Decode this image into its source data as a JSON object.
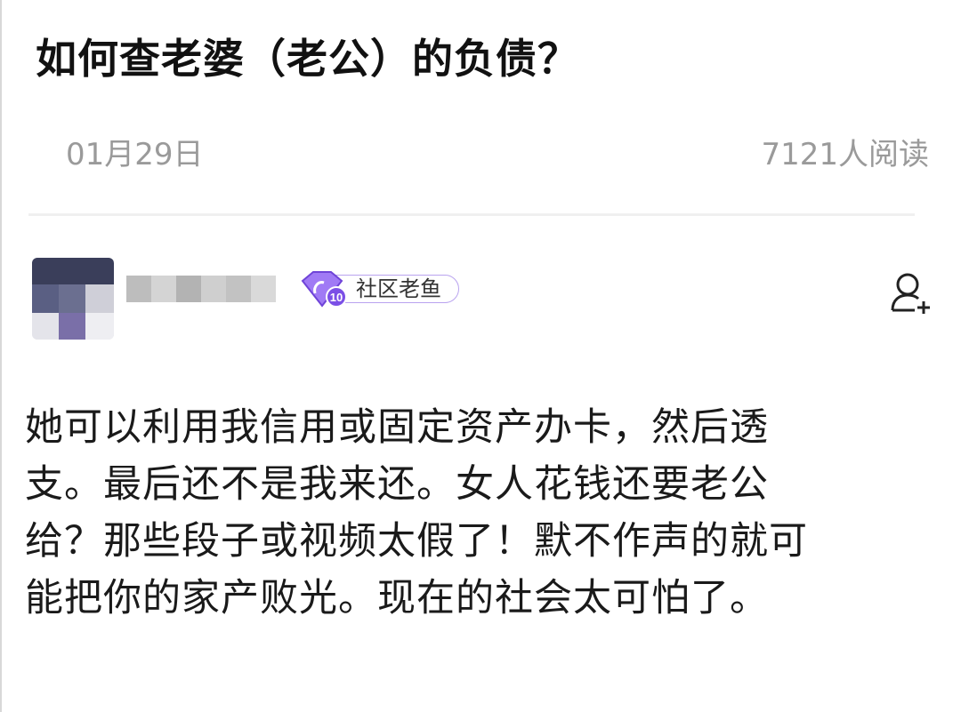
{
  "post": {
    "title": "如何查老婆（老公）的负债？",
    "date": "01月29日",
    "reads": "7121人阅读"
  },
  "author": {
    "badge": {
      "level": "10",
      "label": "社区老鱼"
    }
  },
  "content": {
    "lines": [
      "她可以利用我信用或固定资产办卡，然后透",
      "支。最后还不是我来还。女人花钱还要老公",
      "给？那些段子或视频太假了！默不作声的就可",
      "能把你的家产败光。现在的社会太可怕了。"
    ]
  },
  "icons": {
    "follow": "follow-user-icon",
    "level": "fish-level-icon"
  },
  "colors": {
    "title": "#111111",
    "meta": "#9a9a9a",
    "badge_accent": "#8a5cf0",
    "badge_border": "#b9a3ef"
  }
}
